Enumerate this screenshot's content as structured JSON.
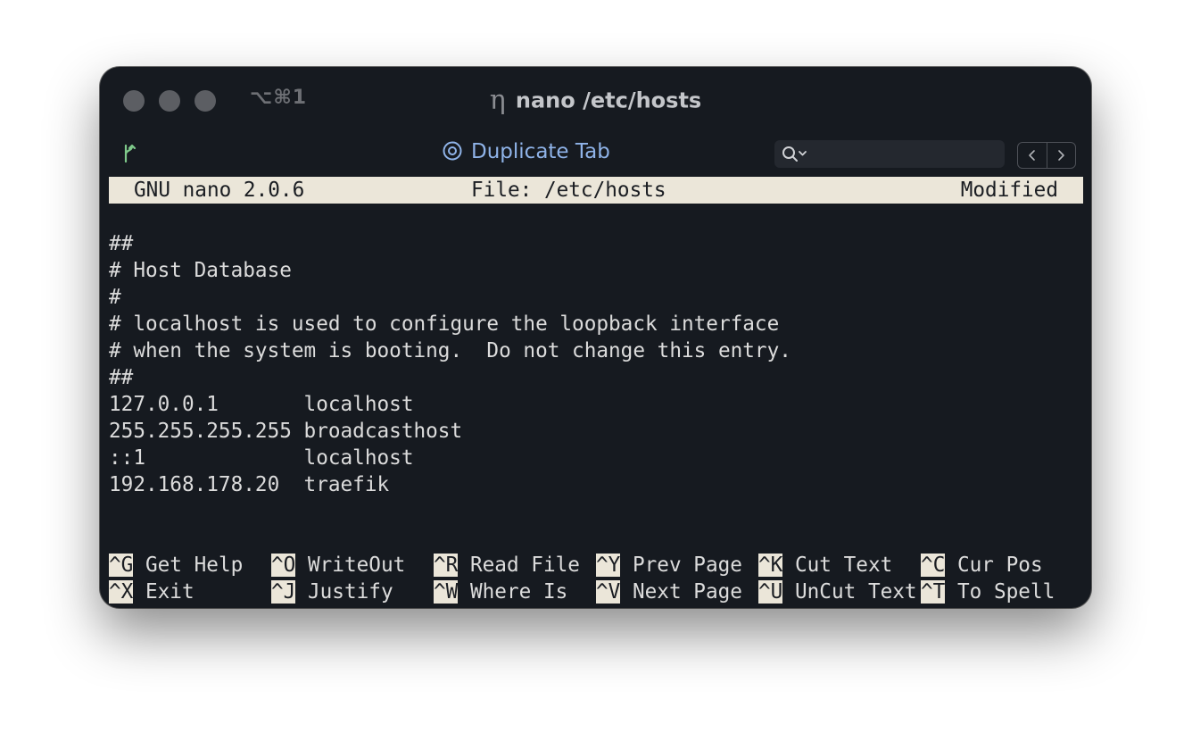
{
  "window": {
    "shortcut": "⌥⌘1",
    "title_glyph": "η",
    "title": "nano /etc/hosts",
    "icons": [
      "branch-icon",
      "target-icon",
      "search-icon",
      "chevron-down-icon",
      "chevron-left-icon",
      "chevron-right-icon"
    ]
  },
  "toolbar": {
    "duplicate_tab_label": "Duplicate Tab",
    "search_placeholder": ""
  },
  "nano": {
    "header": {
      "version": "GNU nano 2.0.6",
      "file": "File: /etc/hosts",
      "status": "Modified"
    },
    "lines": [
      "",
      "##",
      "# Host Database",
      "#",
      "# localhost is used to configure the loopback interface",
      "# when the system is booting.  Do not change this entry.",
      "##",
      "127.0.0.1       localhost",
      "255.255.255.255 broadcasthost",
      "::1             localhost",
      "192.168.178.20  traefik",
      "",
      ""
    ],
    "help": [
      [
        {
          "key": "^G",
          "label": " Get Help"
        },
        {
          "key": "^O",
          "label": " WriteOut"
        },
        {
          "key": "^R",
          "label": " Read File"
        },
        {
          "key": "^Y",
          "label": " Prev Page"
        },
        {
          "key": "^K",
          "label": " Cut Text"
        },
        {
          "key": "^C",
          "label": " Cur Pos"
        }
      ],
      [
        {
          "key": "^X",
          "label": " Exit"
        },
        {
          "key": "^J",
          "label": " Justify"
        },
        {
          "key": "^W",
          "label": " Where Is"
        },
        {
          "key": "^V",
          "label": " Next Page"
        },
        {
          "key": "^U",
          "label": " UnCut Text"
        },
        {
          "key": "^T",
          "label": " To Spell"
        }
      ]
    ]
  },
  "colors": {
    "background": "#161a20",
    "nano_bar": "#ebe6d9",
    "text": "#dcdcdc",
    "accent_blue": "#8fb3e8",
    "branch_green": "#7ec98a"
  }
}
